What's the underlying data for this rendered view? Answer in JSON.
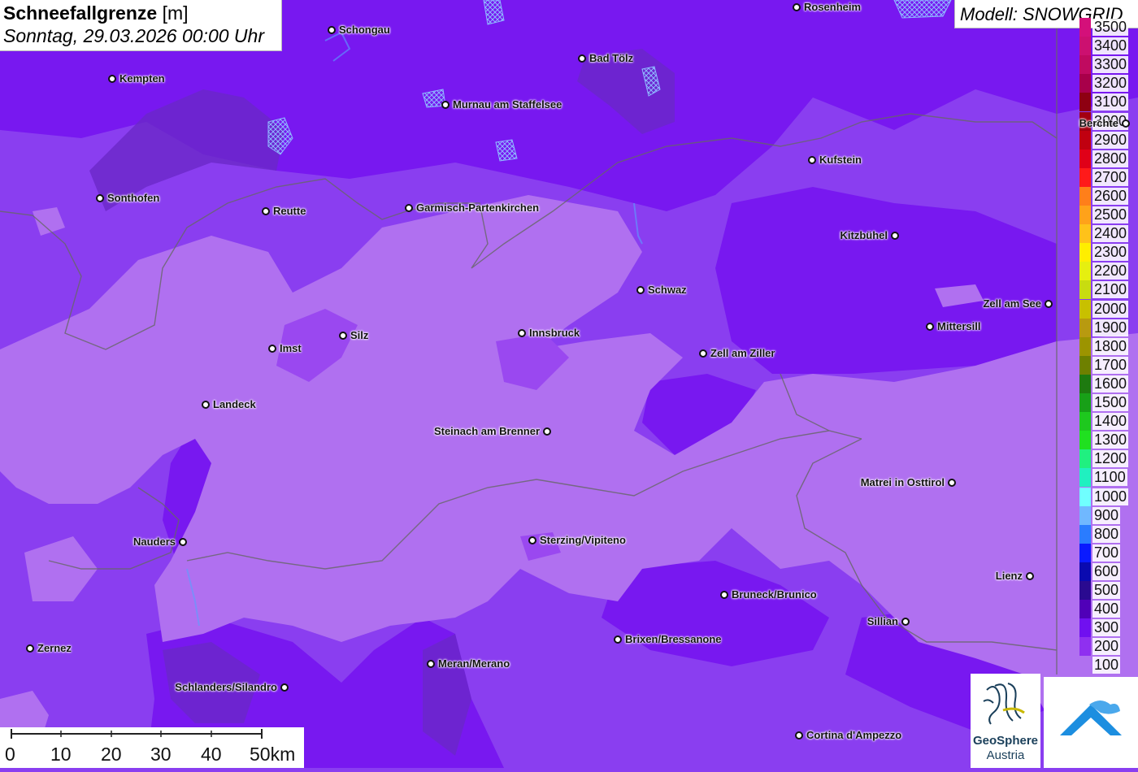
{
  "title": {
    "main_bold": "Schneefallgrenze",
    "main_unit": "[m]",
    "subtitle": "Sonntag, 29.03.2026 00:00 Uhr"
  },
  "model": {
    "label": "Modell: SNOWGRID"
  },
  "legend": {
    "items": [
      {
        "label": "3500",
        "color": "#d4107a"
      },
      {
        "label": "3400",
        "color": "#cc1070"
      },
      {
        "label": "3300",
        "color": "#c00a60"
      },
      {
        "label": "3200",
        "color": "#a8004a"
      },
      {
        "label": "3100",
        "color": "#8e0012"
      },
      {
        "label": "3000",
        "color": "#a30010"
      },
      {
        "label": "2900",
        "color": "#c00010"
      },
      {
        "label": "2800",
        "color": "#e00018"
      },
      {
        "label": "2700",
        "color": "#ff1a1a"
      },
      {
        "label": "2600",
        "color": "#ff7f1a"
      },
      {
        "label": "2500",
        "color": "#ffa21a"
      },
      {
        "label": "2400",
        "color": "#ffc21a"
      },
      {
        "label": "2300",
        "color": "#ffee00"
      },
      {
        "label": "2200",
        "color": "#e6ef10"
      },
      {
        "label": "2100",
        "color": "#c8dc10"
      },
      {
        "label": "2000",
        "color": "#c8c000"
      },
      {
        "label": "1900",
        "color": "#b89a10"
      },
      {
        "label": "1800",
        "color": "#9c9400"
      },
      {
        "label": "1700",
        "color": "#6e8000"
      },
      {
        "label": "1600",
        "color": "#1e7a10"
      },
      {
        "label": "1500",
        "color": "#18a018"
      },
      {
        "label": "1400",
        "color": "#1ec81e"
      },
      {
        "label": "1300",
        "color": "#20e020"
      },
      {
        "label": "1200",
        "color": "#20f080"
      },
      {
        "label": "1100",
        "color": "#20f0c0"
      },
      {
        "label": "1000",
        "color": "#70ffff"
      },
      {
        "label": "900",
        "color": "#70b8ff"
      },
      {
        "label": "800",
        "color": "#2a7cff"
      },
      {
        "label": "700",
        "color": "#0a1aff"
      },
      {
        "label": "600",
        "color": "#0a0ab0"
      },
      {
        "label": "500",
        "color": "#2a0a90"
      },
      {
        "label": "400",
        "color": "#5000b8"
      },
      {
        "label": "300",
        "color": "#7010f0"
      },
      {
        "label": "200",
        "color": "#8f30f0"
      },
      {
        "label": "100",
        "color": "#b070f0"
      }
    ]
  },
  "cities": [
    {
      "name": "Rosenheim"
    },
    {
      "name": "Schongau"
    },
    {
      "name": "Kempten"
    },
    {
      "name": "Bad Tölz"
    },
    {
      "name": "Murnau am Staffelsee"
    },
    {
      "name": "Berchte"
    },
    {
      "name": "Kufstein"
    },
    {
      "name": "Sonthofen"
    },
    {
      "name": "Reutte"
    },
    {
      "name": "Garmisch-Partenkirchen"
    },
    {
      "name": "Kitzbühel"
    },
    {
      "name": "Schwaz"
    },
    {
      "name": "Zell am See"
    },
    {
      "name": "Mittersill"
    },
    {
      "name": "Innsbruck"
    },
    {
      "name": "Imst"
    },
    {
      "name": "Silz"
    },
    {
      "name": "Zell am Ziller"
    },
    {
      "name": "Landeck"
    },
    {
      "name": "Steinach am Brenner"
    },
    {
      "name": "Matrei in Osttirol"
    },
    {
      "name": "Nauders"
    },
    {
      "name": "Sterzing/Vipiteno"
    },
    {
      "name": "Lienz"
    },
    {
      "name": "Bruneck/Brunico"
    },
    {
      "name": "Sillian"
    },
    {
      "name": "Brixen/Bressanone"
    },
    {
      "name": "Zernez"
    },
    {
      "name": "Meran/Merano"
    },
    {
      "name": "Schlanders/Silandro"
    },
    {
      "name": "Cortina d'Ampezzo"
    }
  ],
  "scale": {
    "labels": [
      "0",
      "10",
      "20",
      "30",
      "40",
      "50km"
    ]
  },
  "logo": {
    "line1": "GeoSphere",
    "line2": "Austria"
  }
}
